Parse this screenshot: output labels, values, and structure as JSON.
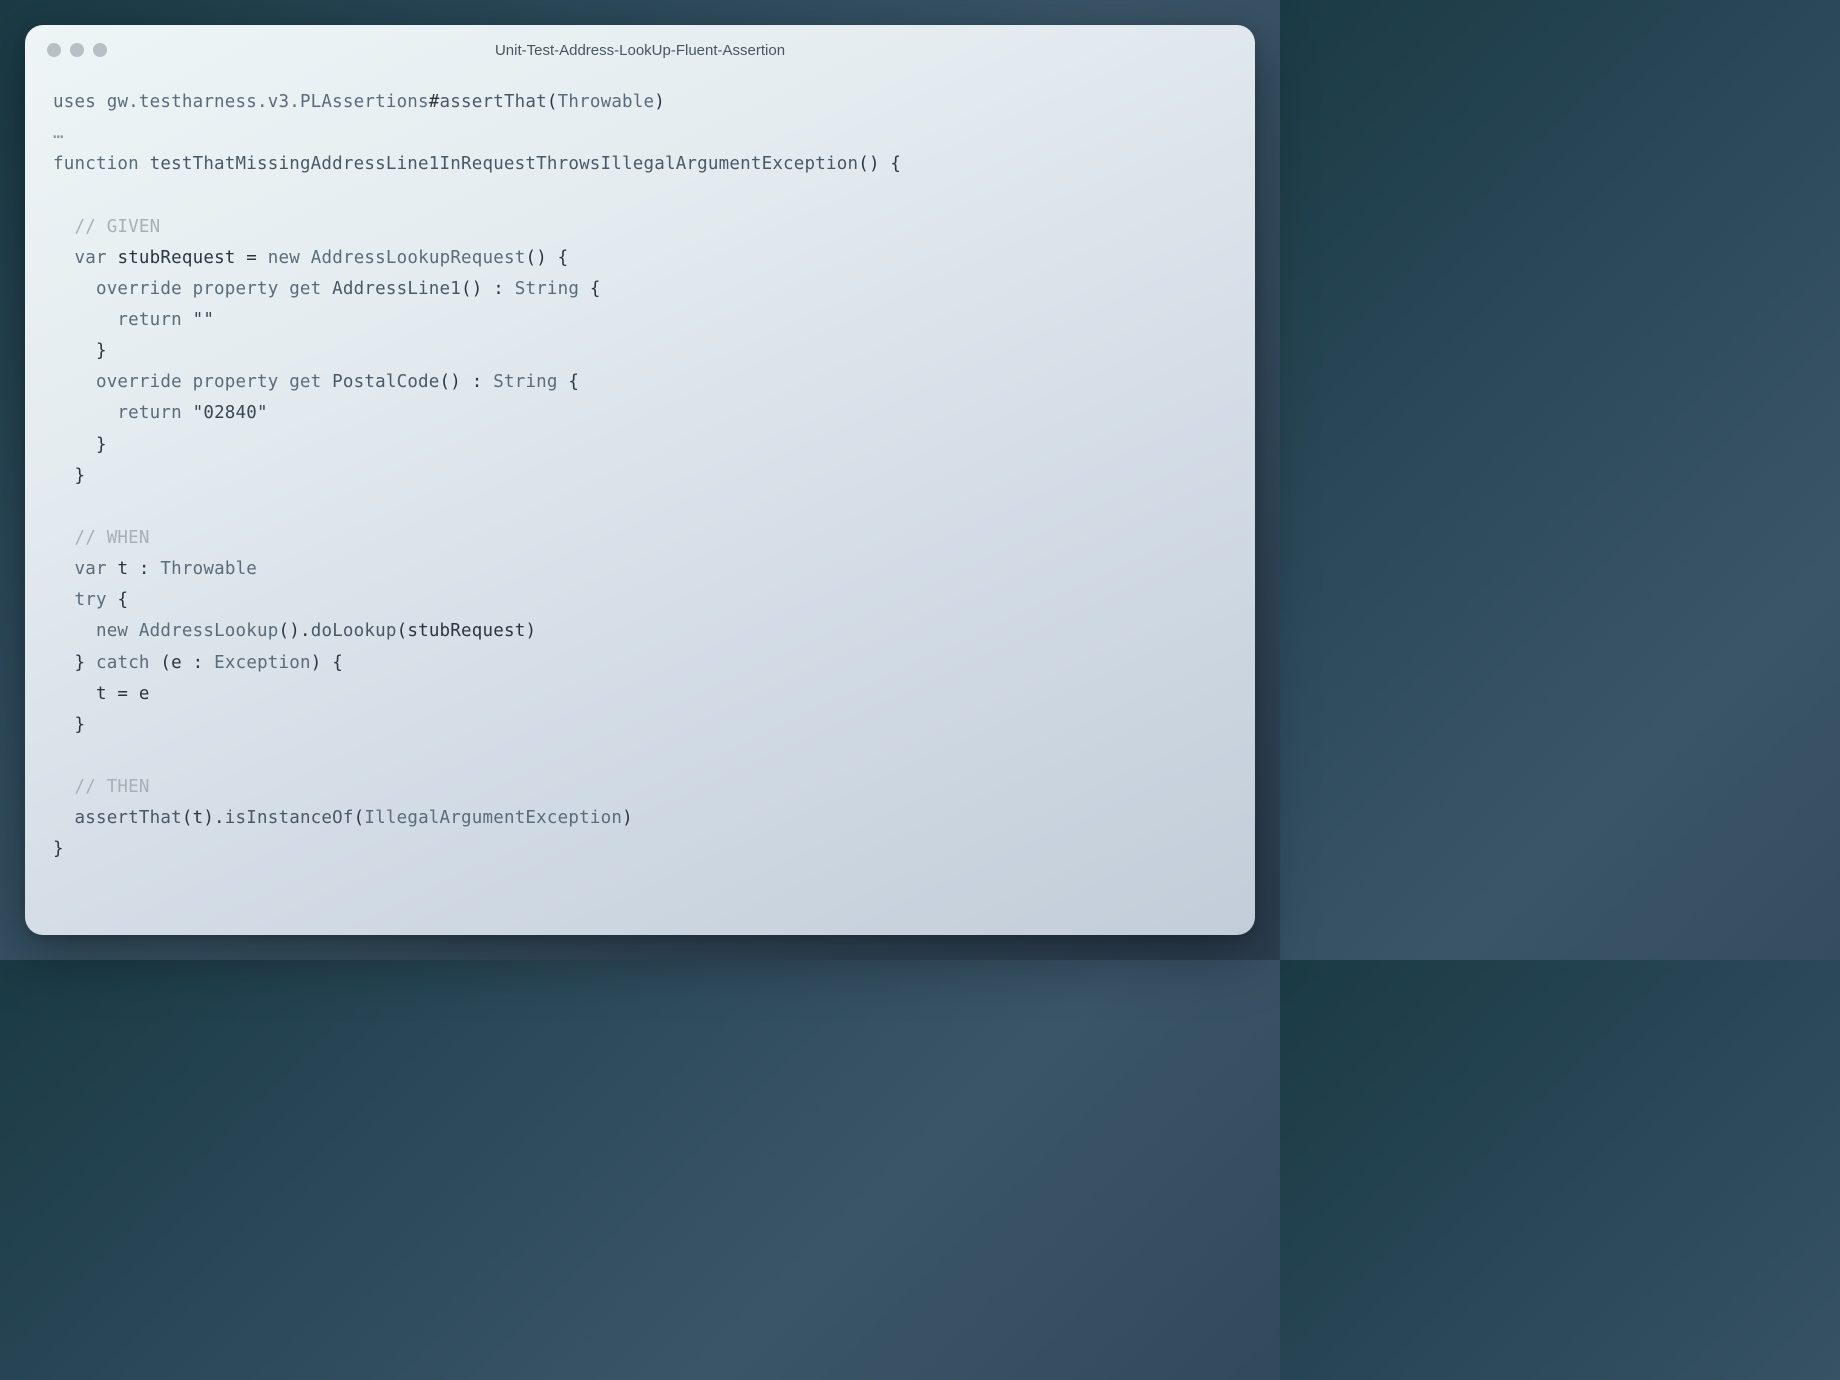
{
  "window": {
    "title": "Unit-Test-Address-LookUp-Fluent-Assertion"
  },
  "code": {
    "l1_uses": "uses",
    "l1_pkg": "gw.testharness.v3.PLAssertions",
    "l1_hash": "#",
    "l1_assertThat": "assertThat",
    "l1_paren_open": "(",
    "l1_throwable": "Throwable",
    "l1_paren_close": ")",
    "l2_ellipsis": "…",
    "l3_function": "function",
    "l3_name": "testThatMissingAddressLine1InRequestThrowsIllegalArgumentException",
    "l3_sig": "() {",
    "l5_given": "// GIVEN",
    "l6_var": "var",
    "l6_stub": "stubRequest =",
    "l6_new": "new",
    "l6_type": "AddressLookupRequest",
    "l6_tail": "() {",
    "l7_override": "override property get",
    "l7_name": "AddressLine1",
    "l7_sig": "() :",
    "l7_type": "String",
    "l7_brace": "{",
    "l8_return": "return",
    "l8_val": "\"\"",
    "l9_brace": "}",
    "l10_override": "override property get",
    "l10_name": "PostalCode",
    "l10_sig": "() :",
    "l10_type": "String",
    "l10_brace": "{",
    "l11_return": "return",
    "l11_val": "\"02840\"",
    "l12_brace": "}",
    "l13_brace": "}",
    "l15_when": "// WHEN",
    "l16_var": "var",
    "l16_t": "t :",
    "l16_type": "Throwable",
    "l17_try": "try",
    "l17_brace": "{",
    "l18_new": "new",
    "l18_type": "AddressLookup",
    "l18_paren": "().",
    "l18_fn": "doLookup",
    "l18_arg": "(stubRequest)",
    "l19_catch_open": "}",
    "l19_catch": "catch",
    "l19_catch_sig_open": "(e :",
    "l19_exc": "Exception",
    "l19_catch_sig_close": ") {",
    "l20_assign": "t = e",
    "l21_brace": "}",
    "l23_then": "// THEN",
    "l24_assert": "assertThat",
    "l24_t": "(t).",
    "l24_inst": "isInstanceOf",
    "l24_paren_open": "(",
    "l24_type": "IllegalArgumentException",
    "l24_paren_close": ")",
    "l25_brace": "}"
  }
}
